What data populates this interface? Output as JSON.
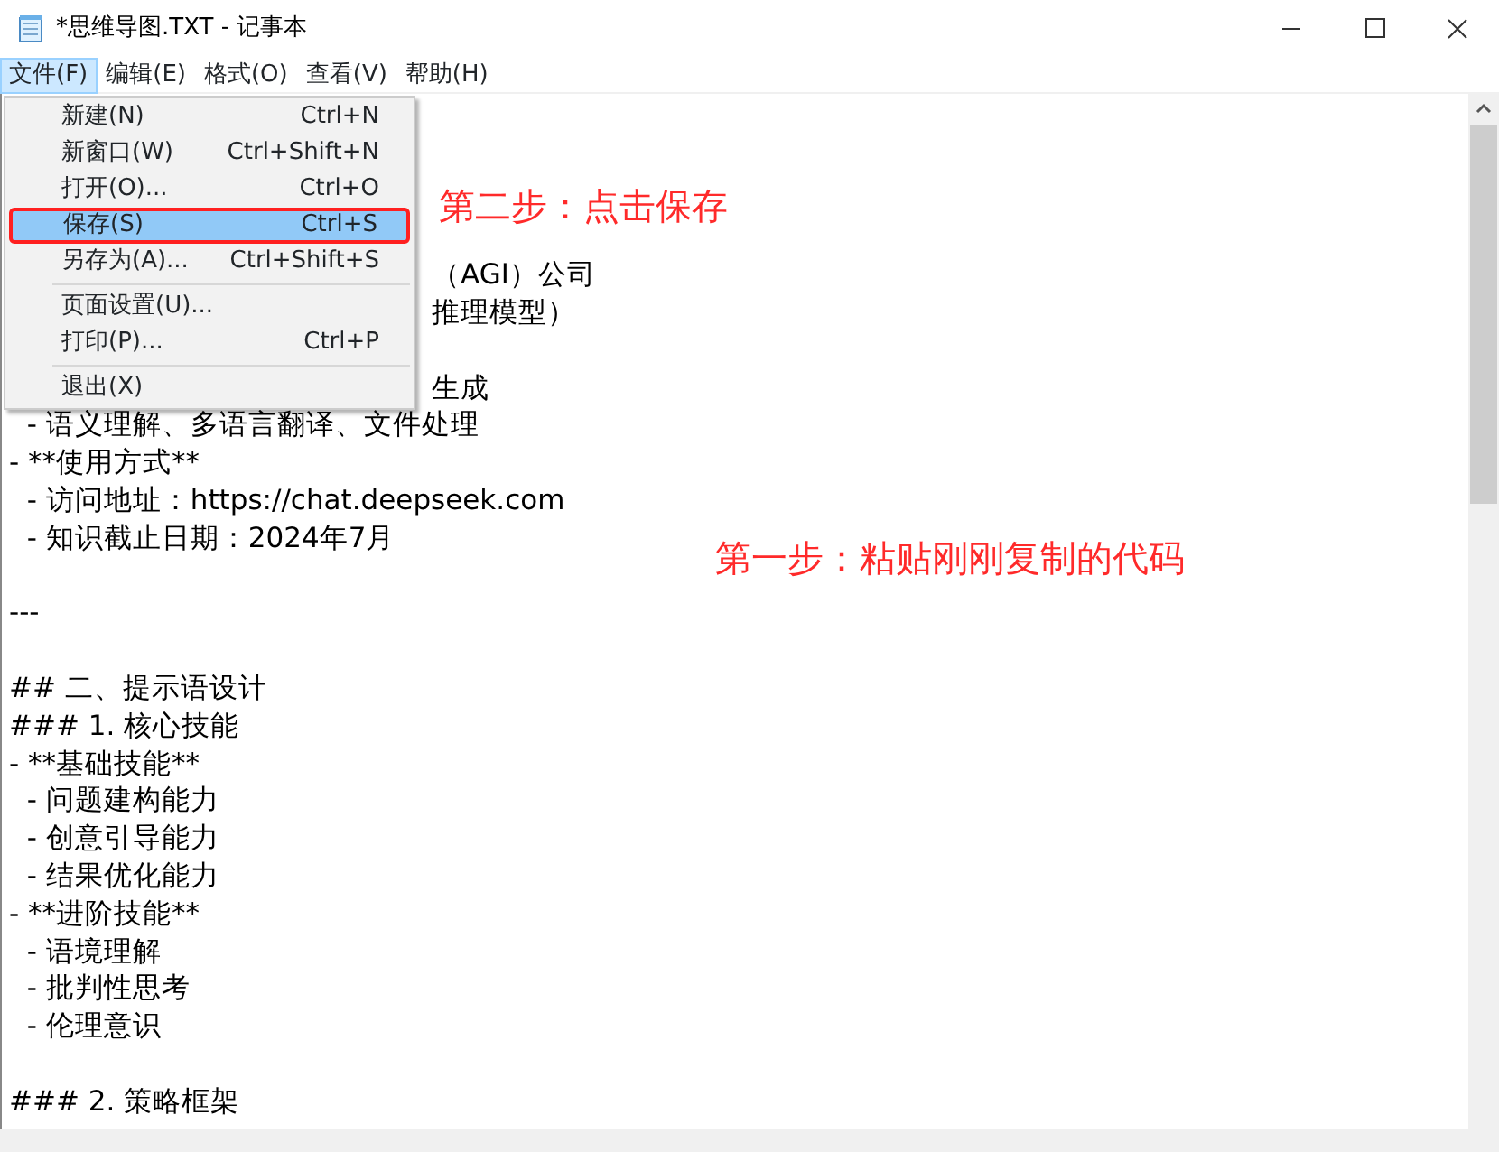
{
  "window": {
    "title": "*思维导图.TXT - 记事本"
  },
  "menu_bar": [
    {
      "label": "文件(F)",
      "selected": true
    },
    {
      "label": "编辑(E)",
      "selected": false
    },
    {
      "label": "格式(O)",
      "selected": false
    },
    {
      "label": "查看(V)",
      "selected": false
    },
    {
      "label": "帮助(H)",
      "selected": false
    }
  ],
  "file_menu": [
    {
      "kind": "item",
      "label": "新建(N)",
      "shortcut": "Ctrl+N",
      "selected": false,
      "boxed": false
    },
    {
      "kind": "item",
      "label": "新窗口(W)",
      "shortcut": "Ctrl+Shift+N",
      "selected": false,
      "boxed": false
    },
    {
      "kind": "item",
      "label": "打开(O)...",
      "shortcut": "Ctrl+O",
      "selected": false,
      "boxed": false
    },
    {
      "kind": "item",
      "label": "保存(S)",
      "shortcut": "Ctrl+S",
      "selected": true,
      "boxed": true
    },
    {
      "kind": "item",
      "label": "另存为(A)...",
      "shortcut": "Ctrl+Shift+S",
      "selected": false,
      "boxed": false
    },
    {
      "kind": "separator"
    },
    {
      "kind": "item",
      "label": "页面设置(U)...",
      "selected": false,
      "boxed": false
    },
    {
      "kind": "item",
      "label": "打印(P)...",
      "shortcut": "Ctrl+P",
      "selected": false,
      "boxed": false
    },
    {
      "kind": "separator"
    },
    {
      "kind": "item",
      "label": "退出(X)",
      "selected": false,
      "boxed": false
    }
  ],
  "editor": {
    "lines": [
      {
        "kind": "blank"
      },
      {
        "kind": "blank"
      },
      {
        "kind": "blank"
      },
      {
        "kind": "blank"
      },
      {
        "kind": "partial",
        "text": "（AGI）公司"
      },
      {
        "kind": "partial",
        "text": "推理模型）"
      },
      {
        "kind": "blank"
      },
      {
        "kind": "partial",
        "text": "生成"
      },
      {
        "kind": "text",
        "text": "  - 语义理解、多语言翻译、文件处理"
      },
      {
        "kind": "text",
        "text": "- **使用方式**"
      },
      {
        "kind": "text",
        "text": "  - 访问地址：https://chat.deepseek.com"
      },
      {
        "kind": "text",
        "text": "  - 知识截止日期：2024年7月"
      },
      {
        "kind": "blank"
      },
      {
        "kind": "text",
        "text": "---"
      },
      {
        "kind": "blank"
      },
      {
        "kind": "text",
        "text": "## 二、提示语设计"
      },
      {
        "kind": "text",
        "text": "### 1. 核心技能"
      },
      {
        "kind": "text",
        "text": "- **基础技能**"
      },
      {
        "kind": "text",
        "text": "  - 问题建构能力"
      },
      {
        "kind": "text",
        "text": "  - 创意引导能力"
      },
      {
        "kind": "text",
        "text": "  - 结果优化能力"
      },
      {
        "kind": "text",
        "text": "- **进阶技能**"
      },
      {
        "kind": "text",
        "text": "  - 语境理解"
      },
      {
        "kind": "text",
        "text": "  - 批判性思考"
      },
      {
        "kind": "text",
        "text": "  - 伦理意识"
      },
      {
        "kind": "blank"
      },
      {
        "kind": "text",
        "text": "### 2. 策略框架"
      }
    ]
  },
  "annotations": [
    {
      "kind": "step2",
      "text": "第二步：点击保存"
    },
    {
      "kind": "step1",
      "text": "第一步：粘贴刚刚复制的代码"
    }
  ]
}
